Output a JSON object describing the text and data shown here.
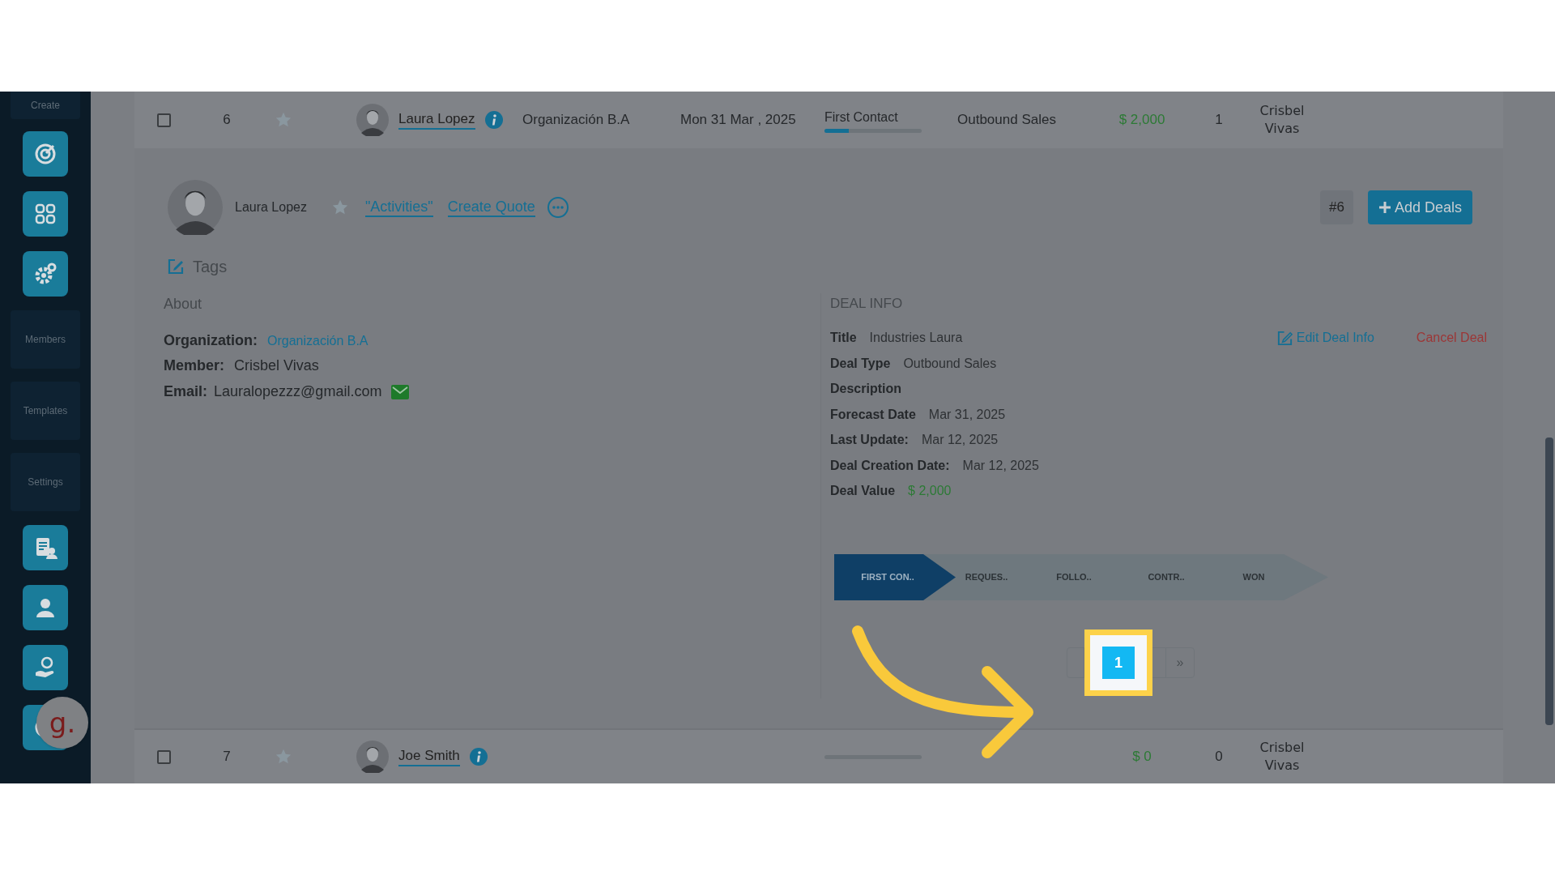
{
  "sidebar": {
    "items": [
      {
        "kind": "label",
        "label": "Create"
      },
      {
        "kind": "icon"
      },
      {
        "kind": "icon"
      },
      {
        "kind": "icon"
      },
      {
        "kind": "label",
        "label": "Members"
      },
      {
        "kind": "label",
        "label": "Templates"
      },
      {
        "kind": "label",
        "label": "Settings"
      },
      {
        "kind": "icon"
      },
      {
        "kind": "icon"
      },
      {
        "kind": "icon"
      },
      {
        "kind": "icon"
      }
    ]
  },
  "help_bubble": {
    "label": "g."
  },
  "deals": [
    {
      "number": "6",
      "starred": false,
      "name": "Laura Lopez",
      "organization": "Organización B.A",
      "date": "Mon 31 Mar , 2025",
      "stage": "First Contact",
      "level": 0.25,
      "deal_type": "Outbound Sales",
      "value": "$ 2,000",
      "count": "1",
      "member": "Crisbel Vivas",
      "checked": false
    },
    {
      "number": "7",
      "starred": false,
      "name": "Joe Smith",
      "level": 0,
      "value": "$ 0",
      "count": "0",
      "member": "Crisbel Vivas",
      "checked": false
    }
  ],
  "detail": {
    "name": "Laura Lopez",
    "links": [
      "\"Activities\"",
      "Create Quote"
    ],
    "badge": "#6",
    "add_button": "Add Deals",
    "tags": "Tags",
    "about": {
      "heading": "About",
      "fields": [
        {
          "label": "Organization:",
          "value": "Organización B.A",
          "kind": "link"
        },
        {
          "label": "Member:",
          "value": "Crisbel Vivas",
          "kind": "text"
        },
        {
          "label": "Email:",
          "value": "Lauralopezzz@gmail.com",
          "kind": "email"
        }
      ]
    },
    "deal_info": {
      "heading": "DEAL INFO",
      "edit": "Edit Deal Info",
      "cancel": "Cancel Deal",
      "fields": [
        {
          "label": "Title",
          "value": "Industries Laura",
          "kind": "text"
        },
        {
          "label": "Deal Type",
          "value": "Outbound Sales",
          "kind": "text"
        },
        {
          "label": "Description"
        },
        {
          "label": "Forecast Date",
          "value": "Mar 31, 2025",
          "kind": "text"
        },
        {
          "label": "Last Update:",
          "value": "Mar 12, 2025",
          "kind": "text"
        },
        {
          "label": "Deal Creation Date:",
          "value": "Mar 12, 2025",
          "kind": "text"
        },
        {
          "label": "Deal Value",
          "value": "$ 2,000",
          "kind": "money"
        }
      ]
    },
    "pipeline": [
      {
        "label": "FIRST CON..",
        "selected": true
      },
      {
        "label": "REQUES..",
        "selected": false
      },
      {
        "label": "FOLLO..",
        "selected": false
      },
      {
        "label": "CONTR..",
        "selected": false
      },
      {
        "label": "WON",
        "selected": false
      }
    ],
    "pagination": {
      "pages": [
        {
          "label": "1",
          "selected": true
        }
      ],
      "next": "»"
    }
  }
}
